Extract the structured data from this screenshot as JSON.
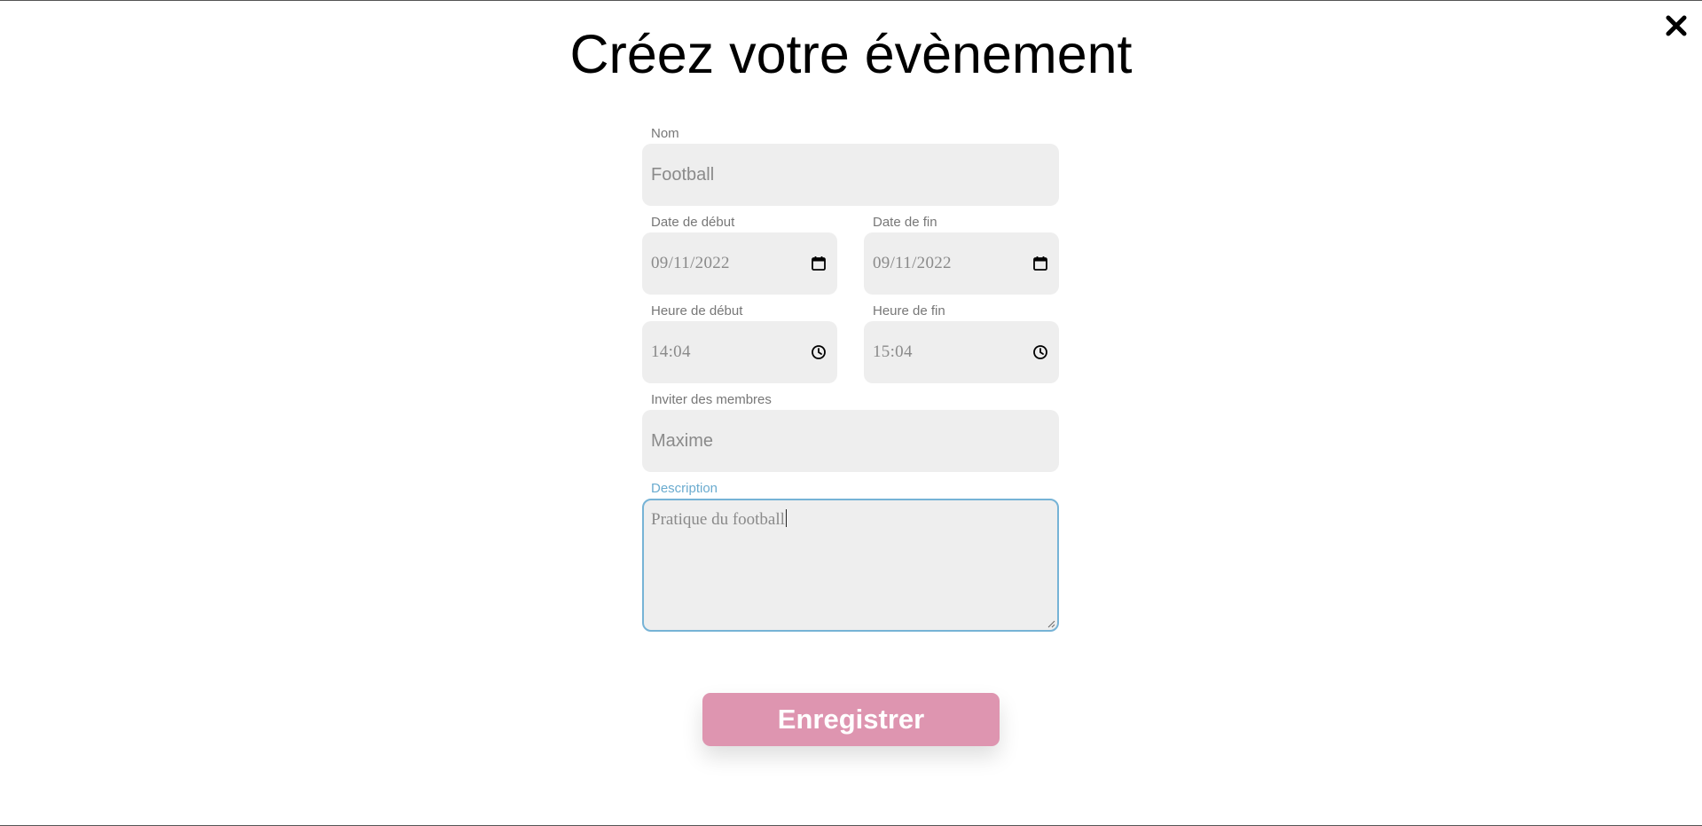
{
  "page": {
    "title": "Créez votre évènement",
    "close_icon": "close-x-icon"
  },
  "form": {
    "name": {
      "label": "Nom",
      "value": "Football"
    },
    "start_date": {
      "label": "Date de début",
      "value": "09/11/2022",
      "icon": "calendar-icon"
    },
    "end_date": {
      "label": "Date de fin",
      "value": "09/11/2022",
      "icon": "calendar-icon"
    },
    "start_time": {
      "label": "Heure de début",
      "value": "14:04",
      "icon": "clock-icon"
    },
    "end_time": {
      "label": "Heure de fin",
      "value": "15:04",
      "icon": "clock-icon"
    },
    "members": {
      "label": "Inviter des membres",
      "value": "Maxime"
    },
    "description": {
      "label": "Description",
      "value": "Pratique du football",
      "focused": true
    },
    "submit_label": "Enregistrer"
  },
  "colors": {
    "field_bg": "#eeeeee",
    "label": "#777777",
    "focus": "#76b3d6",
    "button": "#de95b0",
    "button_text": "#ffffff"
  }
}
